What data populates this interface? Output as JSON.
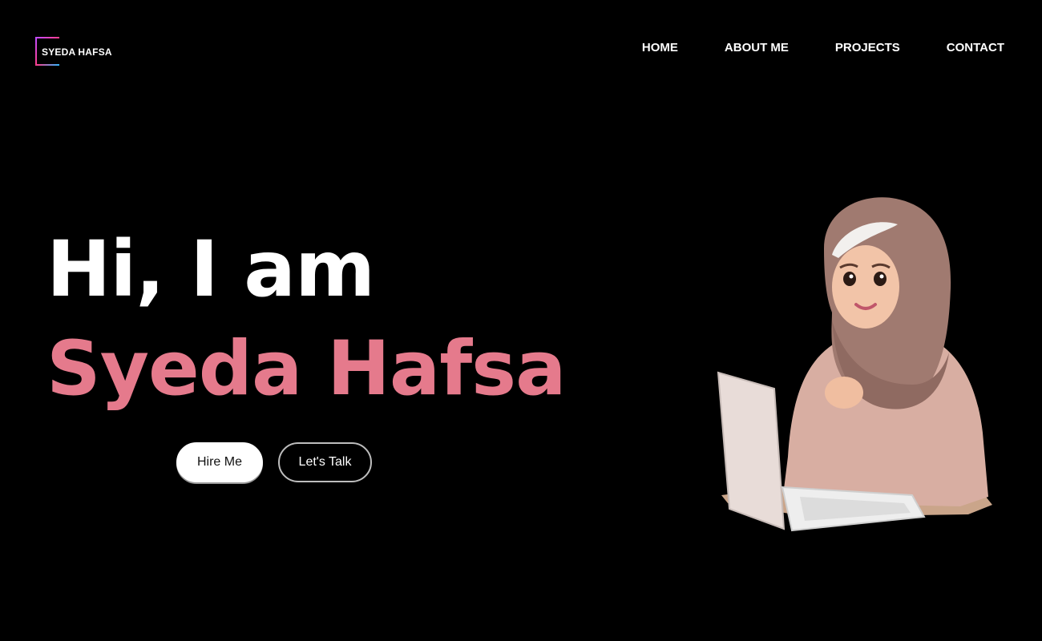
{
  "brand": {
    "logo_text": "SYEDA HAFSA"
  },
  "nav": {
    "items": [
      "HOME",
      "ABOUT ME",
      "PROJECTS",
      "CONTACT"
    ]
  },
  "hero": {
    "greeting": "Hi, I am",
    "name": "Syeda Hafsa",
    "buttons": {
      "hire": "Hire Me",
      "talk": "Let's Talk"
    },
    "illustration_icon": "avatar-hijab-girl-with-laptop"
  },
  "colors": {
    "background": "#000000",
    "text": "#ffffff",
    "accent": "#e57a8c"
  }
}
